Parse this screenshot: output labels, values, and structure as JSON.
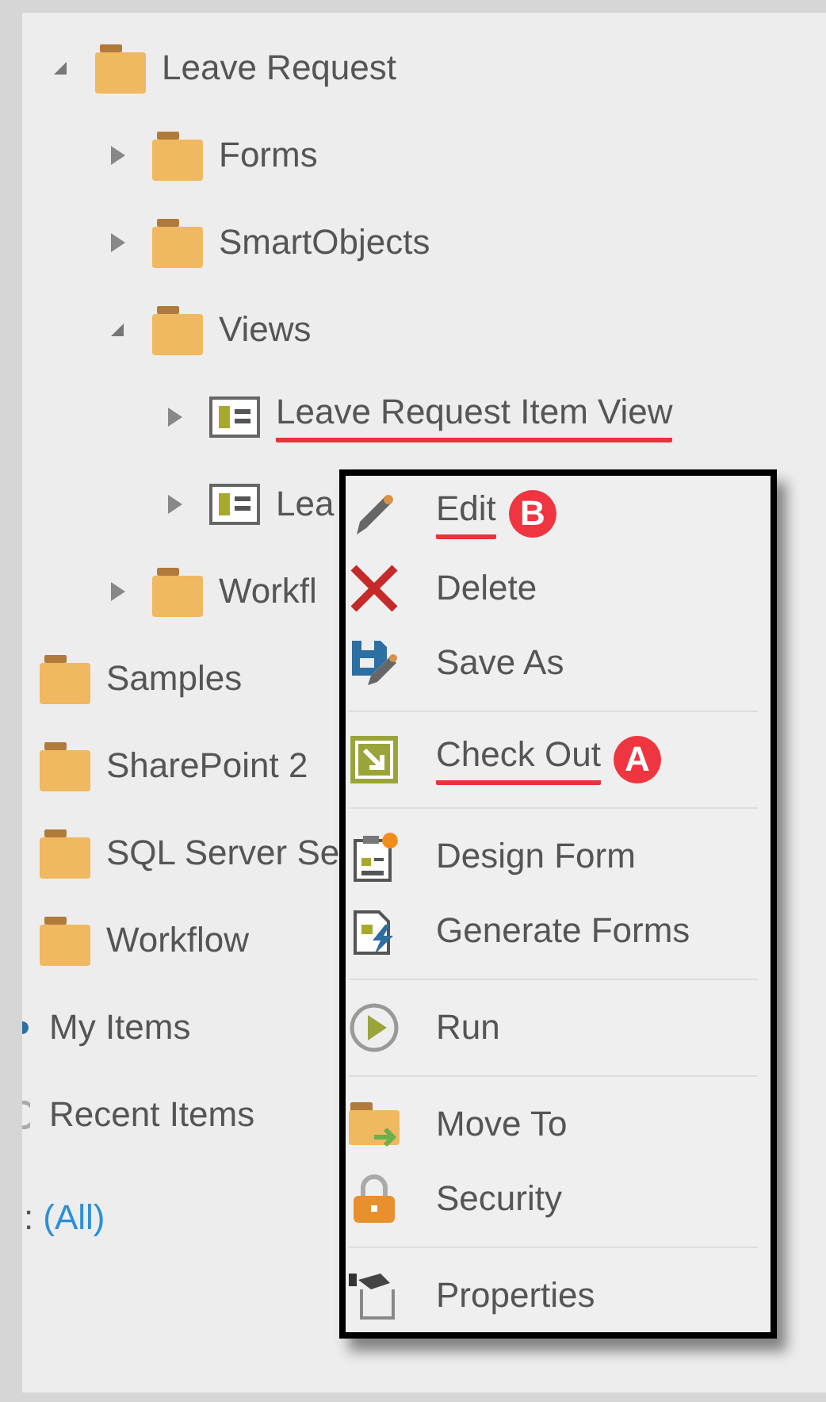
{
  "tree": [
    {
      "label": "Leave Request",
      "kind": "folder",
      "expanded": true,
      "underlined": false,
      "children": [
        {
          "label": "Forms",
          "kind": "folder",
          "expanded": false,
          "underlined": false
        },
        {
          "label": "SmartObjects",
          "kind": "folder",
          "expanded": false,
          "underlined": false
        },
        {
          "label": "Views",
          "kind": "folder",
          "expanded": true,
          "underlined": false,
          "children": [
            {
              "label": "Leave Request Item View",
              "kind": "view",
              "expanded": false,
              "underlined": true
            },
            {
              "label": "Lea",
              "kind": "view",
              "expanded": false,
              "underlined": false
            }
          ]
        },
        {
          "label": "Workfl",
          "kind": "folder",
          "expanded": false,
          "underlined": false
        }
      ]
    }
  ],
  "folders": [
    {
      "label": "Samples"
    },
    {
      "label": "SharePoint 2"
    },
    {
      "label": "SQL Server Se"
    },
    {
      "label": "Workflow"
    }
  ],
  "nav_items": [
    {
      "label": "My Items",
      "kind": "user"
    },
    {
      "label": "Recent Items",
      "kind": "recent"
    }
  ],
  "filter": {
    "label": ":",
    "value": "(All)"
  },
  "context_menu": {
    "groups": [
      [
        {
          "label": "Edit",
          "kind": "pencil",
          "underlined": true,
          "badge": "B"
        },
        {
          "label": "Delete",
          "kind": "delete",
          "underlined": false
        },
        {
          "label": "Save As",
          "kind": "saveas",
          "underlined": false
        }
      ],
      [
        {
          "label": "Check Out",
          "kind": "checkout",
          "underlined": true,
          "badge": "A"
        }
      ],
      [
        {
          "label": "Design Form",
          "kind": "design",
          "underlined": false
        },
        {
          "label": "Generate Forms",
          "kind": "generate",
          "underlined": false
        }
      ],
      [
        {
          "label": "Run",
          "kind": "run",
          "underlined": false
        }
      ],
      [
        {
          "label": "Move To",
          "kind": "move",
          "underlined": false
        },
        {
          "label": "Security",
          "kind": "lock",
          "underlined": false
        }
      ],
      [
        {
          "label": "Properties",
          "kind": "properties",
          "underlined": false
        }
      ]
    ]
  }
}
